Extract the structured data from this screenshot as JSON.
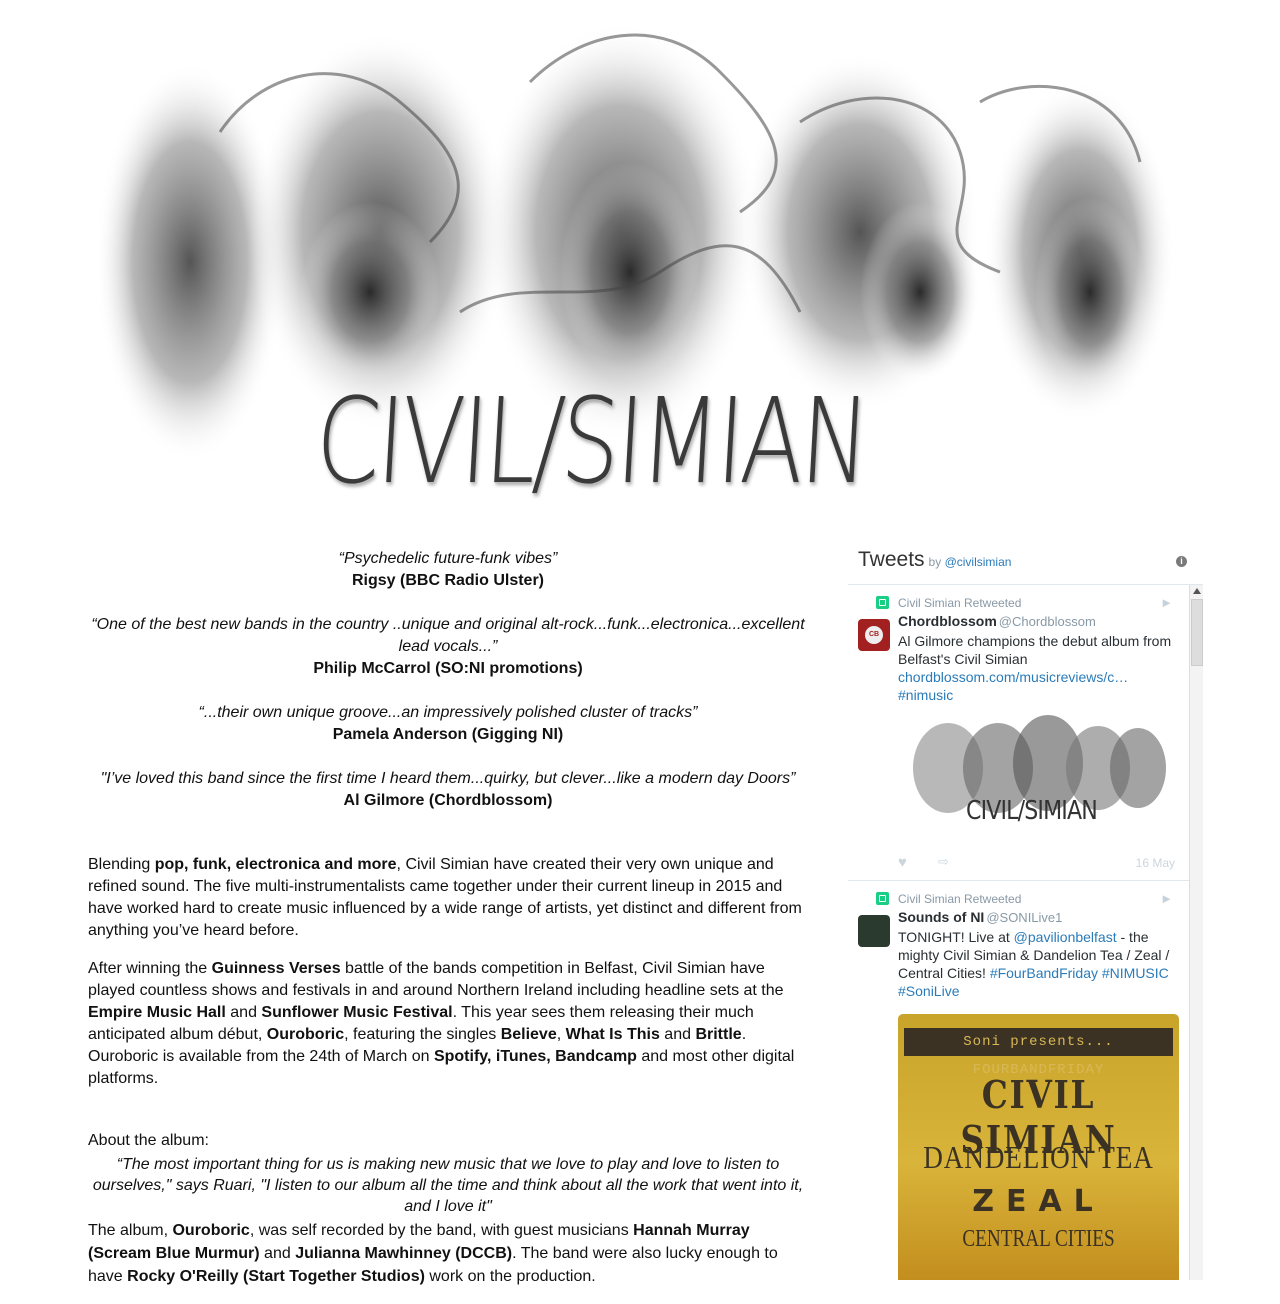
{
  "header": {
    "logo_text": "CIVIL/SIMIAN"
  },
  "quotes": [
    {
      "text": "“Psychedelic future-funk vibes”",
      "author": "Rigsy (BBC Radio Ulster)"
    },
    {
      "text": "“One of the best new bands in the country ..unique and original alt-rock...funk...electronica...excellent lead vocals...”",
      "author": "Philip McCarrol (SO:NI promotions)"
    },
    {
      "text": "“...their own unique groove...an impressively polished cluster of tracks”",
      "author": "Pamela Anderson (Gigging NI)"
    },
    {
      "text": "\"I’ve loved this band since the first time I heard them...quirky, but clever...like a modern day Doors”",
      "author": "Al Gilmore (Chordblossom)"
    }
  ],
  "bio": {
    "p1": {
      "a": "Blending ",
      "b": "pop, funk, electronica and more",
      "c": ", Civil Simian have created their very own unique and refined sound. The five multi-instrumentalists came together under their current lineup in 2015 and have worked hard to create music influenced by a wide range of artists, yet distinct and different from anything you’ve heard before."
    },
    "p2": {
      "a": "After winning the ",
      "b": "Guinness Verses",
      "c": " battle of the bands competition in Belfast, Civil Simian have played countless shows and festivals in and around Northern Ireland including headline sets at the ",
      "d": "Empire Music Hall",
      "e": " and ",
      "f": "Sunflower Music Festival",
      "g": ". This year sees them releasing their much anticipated album début, ",
      "h": "Ouroboric",
      "i": ", featuring the singles ",
      "j": "Believe",
      "k": ", ",
      "l": "What Is This",
      "m": " and ",
      "n": "Brittle",
      "o": ". Ouroboric is available from the 24th of March on ",
      "p": "Spotify, iTunes, Bandcamp",
      "q": " and most other digital platforms."
    }
  },
  "album": {
    "heading": "About the album:",
    "quote": "“The most important thing for us is making new music that we love to play and love to listen to ourselves,\" says Ruari, \"I listen to our album all the time and think about all the work that went into it, and I love it\"",
    "p": {
      "a": "The album, ",
      "b": "Ouroboric",
      "c": ", was self recorded by the band, with guest musicians ",
      "d": "Hannah Murray (Scream Blue Murmur)",
      "e": " and ",
      "f": "Julianna Mawhinney (DCCB)",
      "g": ". The band were also lucky enough to have ",
      "h": "Rocky O'Reilly (Start Together Studios)",
      "i": " work on the production."
    }
  },
  "twitter": {
    "title": "Tweets",
    "by": "by",
    "handle": "@civilsimian",
    "info_glyph": "i",
    "tweets": [
      {
        "retweeted_by": "Civil Simian Retweeted",
        "name": "Chordblossom",
        "handle": "@Chordblossom",
        "avatar_text": "CB",
        "text": "Al Gilmore champions the debut album from Belfast's Civil Simian",
        "link": "chordblossom.com/musicreviews/c…",
        "hashtag": "#nimusic",
        "media_text": "CIVIL/SIMIAN",
        "date": "16 May"
      },
      {
        "retweeted_by": "Civil Simian Retweeted",
        "name": "Sounds of NI",
        "handle": "@SONILive1",
        "text_a": "TONIGHT! Live at ",
        "mention": "@pavilionbelfast",
        "text_b": " - the mighty Civil Simian & Dandelion Tea / Zeal / Central Cities! ",
        "tags_a": "#FourBandFriday #NIMUSIC",
        "tags_b": "#SoniLive",
        "poster": {
          "top": "Soni presents... FOURBANDFRIDAY",
          "line1": "CIVIL SIMIAN",
          "line2": "DANDELION TEA",
          "line3": "ZEAL",
          "line4": "CENTRAL CITIES"
        }
      }
    ]
  },
  "colors": {
    "link": "#2b7bb9",
    "retweet": "#19cf86",
    "muted": "#8899a6"
  }
}
